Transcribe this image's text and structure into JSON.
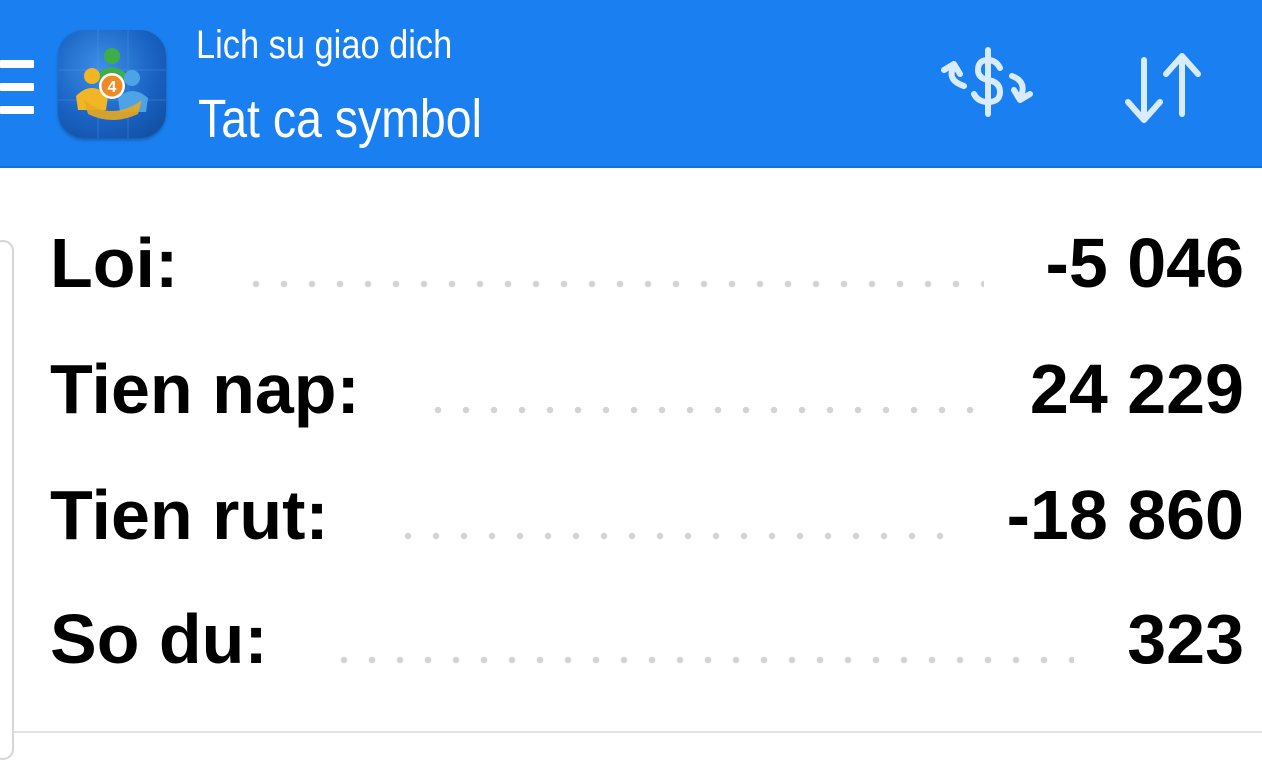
{
  "header": {
    "title": "Lich su giao dich",
    "subtitle": "Tat ca symbol",
    "background_color": "#1a7ff0",
    "menu_icon": "hamburger-menu-icon",
    "app_logo_icon": "metatrader-4-logo-icon",
    "actions": {
      "deposit_withdraw_icon": "dollar-exchange-icon",
      "sort_icon": "sort-arrows-icon"
    }
  },
  "summary": {
    "rows": [
      {
        "label": "Loi:",
        "value": "-5 046"
      },
      {
        "label": "Tien nap:",
        "value": "24 229"
      },
      {
        "label": "Tien rut:",
        "value": "-18 860"
      },
      {
        "label": "So du:",
        "value": "323"
      }
    ]
  }
}
